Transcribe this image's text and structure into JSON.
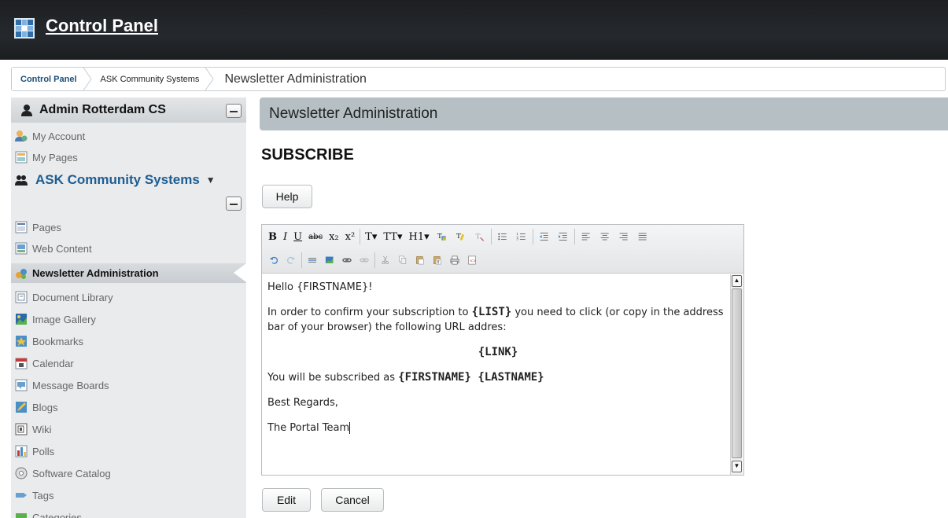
{
  "header": {
    "title": "Control Panel"
  },
  "breadcrumb": {
    "items": [
      "Control Panel",
      "ASK Community Systems",
      "Newsletter Administration"
    ]
  },
  "sidebar": {
    "user_name": "Admin Rotterdam CS",
    "user_items": [
      {
        "label": "My Account",
        "icon": "account-icon"
      },
      {
        "label": "My Pages",
        "icon": "pages-icon"
      }
    ],
    "community_name": "ASK Community Systems",
    "community_dropdown_icon": "▼",
    "items": [
      {
        "label": "Pages",
        "icon": "pages-icon"
      },
      {
        "label": "Web Content",
        "icon": "web-content-icon"
      },
      {
        "label": "Newsletter Administration",
        "icon": "newsletter-icon",
        "active": true
      },
      {
        "label": "Document Library",
        "icon": "document-library-icon"
      },
      {
        "label": "Image Gallery",
        "icon": "image-gallery-icon"
      },
      {
        "label": "Bookmarks",
        "icon": "bookmarks-icon"
      },
      {
        "label": "Calendar",
        "icon": "calendar-icon"
      },
      {
        "label": "Message Boards",
        "icon": "message-boards-icon"
      },
      {
        "label": "Blogs",
        "icon": "blogs-icon"
      },
      {
        "label": "Wiki",
        "icon": "wiki-icon"
      },
      {
        "label": "Polls",
        "icon": "polls-icon"
      },
      {
        "label": "Software Catalog",
        "icon": "software-catalog-icon"
      },
      {
        "label": "Tags",
        "icon": "tags-icon"
      },
      {
        "label": "Categories",
        "icon": "categories-icon"
      }
    ]
  },
  "main": {
    "heading": "Newsletter Administration",
    "section_title": "SUBSCRIBE",
    "help_label": "Help",
    "edit_label": "Edit",
    "cancel_label": "Cancel"
  },
  "editor": {
    "toolbar_row1": [
      "B",
      "I",
      "U",
      "abc",
      "x₂",
      "x²",
      "T▾",
      "TT▾",
      "H1▾"
    ],
    "content": {
      "greeting": "Hello {FIRSTNAME}!",
      "line1_a": "In order to confirm your subscription to ",
      "line1_b": "{LIST}",
      "line1_c": " you need to click (or copy in the address bar of your browser) the following URL addres:",
      "link": "{LINK}",
      "line2_a": "You will be subscribed as ",
      "line2_b": "{FIRSTNAME} {LASTNAME}",
      "regards": "Best Regards,",
      "team": "The Portal Team"
    }
  }
}
